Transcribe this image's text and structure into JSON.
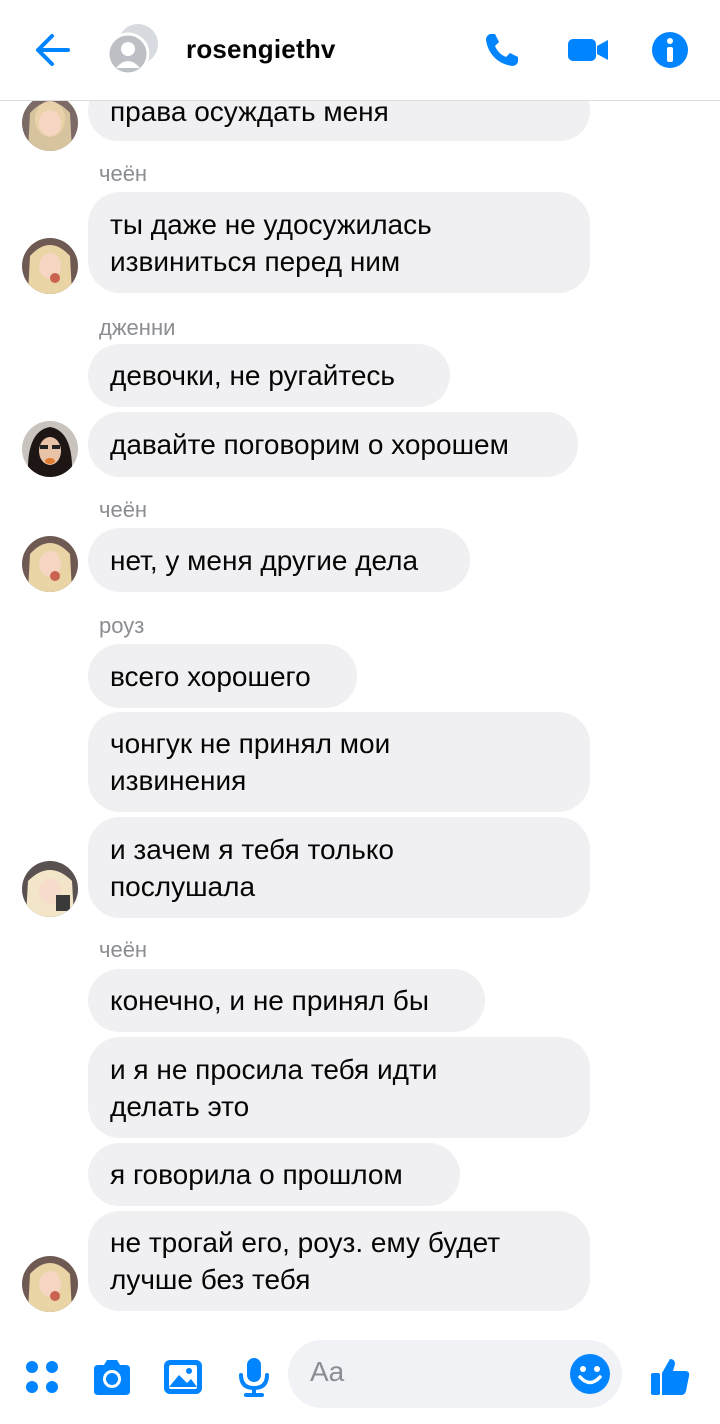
{
  "header": {
    "title": "rosengiethv",
    "icons": [
      "back-arrow-icon",
      "avatar-placeholder-icon",
      "phone-icon",
      "video-camera-icon",
      "info-icon"
    ]
  },
  "colors": {
    "accent": "#0084ff",
    "bubble": "#f0f0f2",
    "name": "#8a8d91"
  },
  "messages": [
    {
      "sender": "",
      "lines": [
        "права осуждать меня"
      ]
    },
    {
      "sender": "чеён",
      "lines": [
        "ты даже не удосужилась",
        "извиниться перед ним"
      ]
    },
    {
      "sender": "дженни",
      "lines": [
        "девочки, не ругайтесь"
      ]
    },
    {
      "sender": "",
      "lines": [
        "давайте поговорим о хорошем"
      ]
    },
    {
      "sender": "чеён",
      "lines": [
        "нет, у меня другие дела"
      ]
    },
    {
      "sender": "роуз",
      "lines": [
        "всего хорошего"
      ]
    },
    {
      "sender": "",
      "lines": [
        "чонгук не принял мои",
        "извинения"
      ]
    },
    {
      "sender": "",
      "lines": [
        "и зачем я тебя только",
        "послушала"
      ]
    },
    {
      "sender": "чеён",
      "lines": [
        "конечно, и не принял бы"
      ]
    },
    {
      "sender": "",
      "lines": [
        "и я не просила тебя идти",
        "делать это"
      ]
    },
    {
      "sender": "",
      "lines": [
        "я говорила о прошлом"
      ]
    },
    {
      "sender": "",
      "lines": [
        "не трогай его, роуз. ему будет",
        "лучше без тебя"
      ]
    }
  ],
  "composer": {
    "placeholder": "Aa",
    "icons": [
      "menu-dots-icon",
      "camera-icon",
      "gallery-icon",
      "microphone-icon",
      "emoji-icon",
      "like-icon"
    ]
  }
}
